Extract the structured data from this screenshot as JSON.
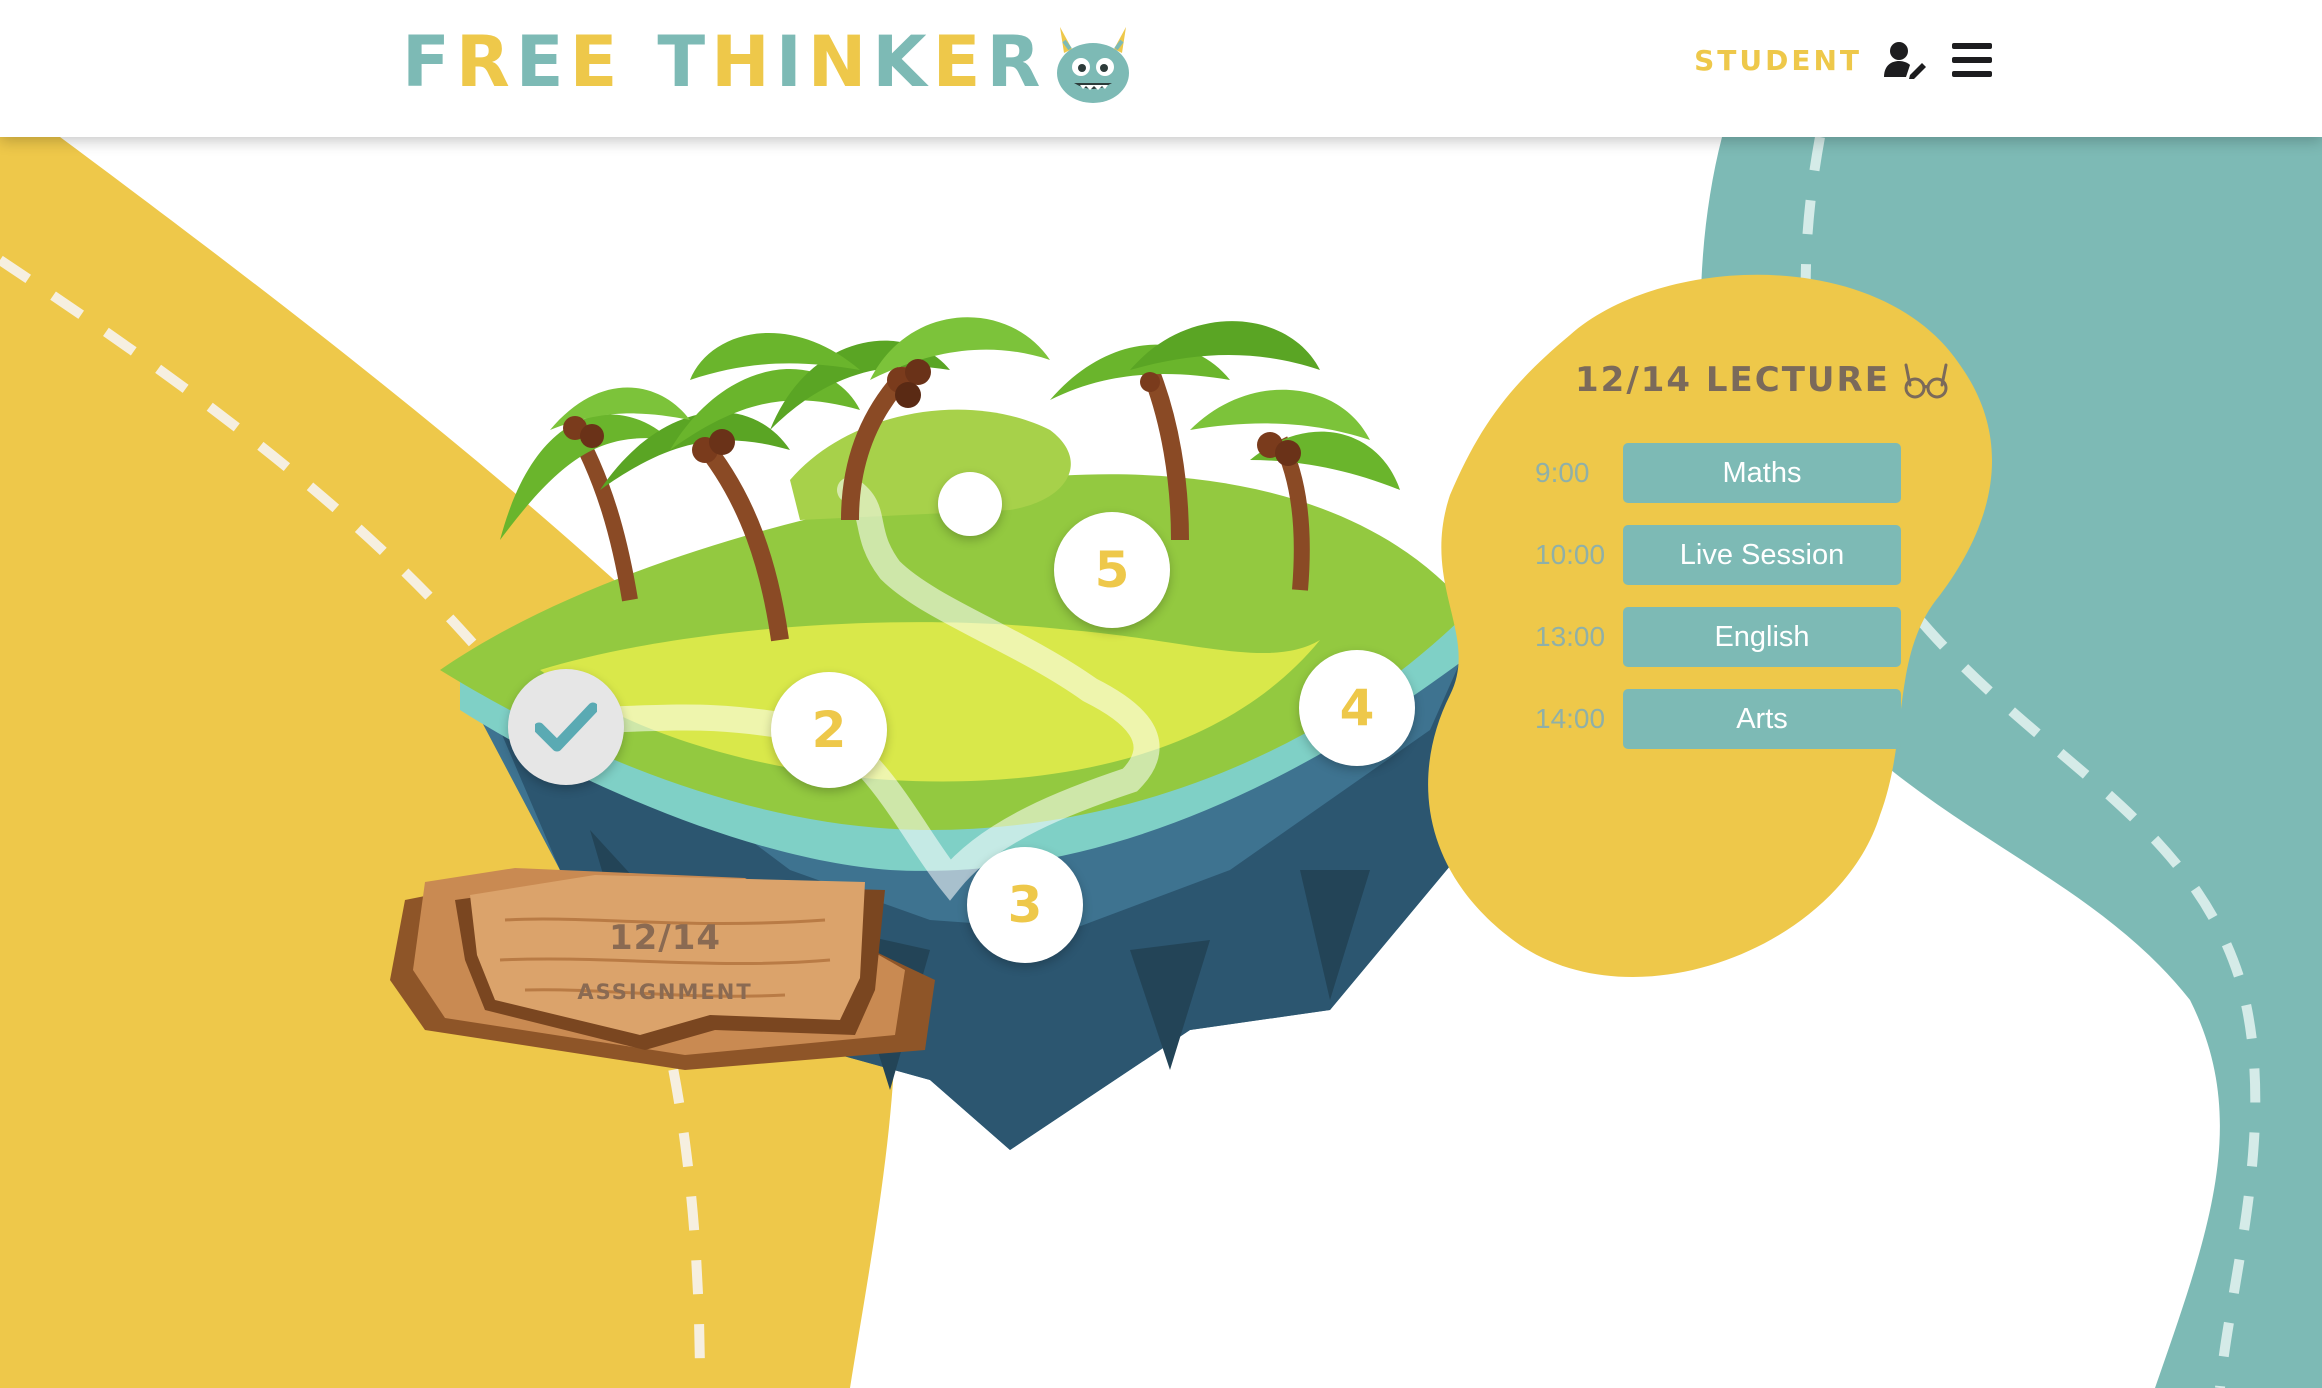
{
  "header": {
    "logo_word1": "FREE",
    "logo_word2": "THINKER",
    "role": "STUDENT",
    "icons": [
      "user-edit-icon",
      "hamburger-menu-icon"
    ]
  },
  "map": {
    "nodes": [
      {
        "label": "✓",
        "status": "completed"
      },
      {
        "label": "2",
        "status": "open"
      },
      {
        "label": "3",
        "status": "open"
      },
      {
        "label": "4",
        "status": "open"
      },
      {
        "label": "5",
        "status": "open"
      },
      {
        "label": "",
        "status": "locked"
      }
    ],
    "sign": {
      "date": "12/14",
      "label": "ASSIGNMENT"
    }
  },
  "lecture": {
    "title": "12/14 LECTURE",
    "icon": "glasses-icon",
    "schedule": [
      {
        "time": "9:00",
        "subject": "Maths"
      },
      {
        "time": "10:00",
        "subject": "Live Session"
      },
      {
        "time": "13:00",
        "subject": "English"
      },
      {
        "time": "14:00",
        "subject": "Arts"
      }
    ]
  },
  "colors": {
    "yellow": "#eec84a",
    "teal": "#7dbab5",
    "brown_text": "#7b6a5a",
    "white": "#ffffff"
  }
}
